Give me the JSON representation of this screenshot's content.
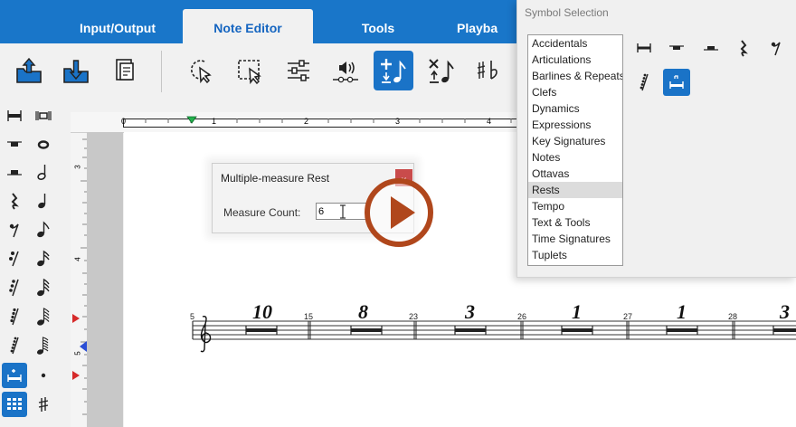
{
  "tabs": [
    "Input/Output",
    "Note Editor",
    "Tools",
    "Playba"
  ],
  "colors": {
    "accent": "#1976c9",
    "close": "#c94b4b",
    "play": "#b0471c"
  },
  "toolbar": {
    "icons": [
      "load-file-icon",
      "save-file-icon",
      "score-settings-icon",
      "pointer-select-icon",
      "region-select-icon",
      "mixer-sliders-icon",
      "audio-speaker-icon",
      "insert-note-icon",
      "delete-note-icon",
      "notation-symbols-icon"
    ]
  },
  "ruler": {
    "labels": [
      "0",
      "1",
      "2",
      "3",
      "4"
    ]
  },
  "vruler": {
    "labels": [
      "3",
      "4",
      "5"
    ]
  },
  "dialog": {
    "title": "Multiple-measure Rest",
    "close_label": "⌄",
    "measure_count_label": "Measure Count:",
    "measure_count_value": "6"
  },
  "symbol_selection": {
    "title": "Symbol Selection",
    "categories": [
      "Accidentals",
      "Articulations",
      "Barlines & Repeats",
      "Clefs",
      "Dynamics",
      "Expressions",
      "Key Signatures",
      "Notes",
      "Ottavas",
      "Rests",
      "Tempo",
      "Text & Tools",
      "Time Signatures",
      "Tuplets"
    ],
    "selected": "Rests"
  },
  "staff": {
    "measures": [
      {
        "number": "5",
        "count": "10"
      },
      {
        "number": "15",
        "count": "8"
      },
      {
        "number": "23",
        "count": "3"
      },
      {
        "number": "26",
        "count": "1"
      },
      {
        "number": "27",
        "count": "1"
      },
      {
        "number": "28",
        "count": "3"
      }
    ]
  }
}
